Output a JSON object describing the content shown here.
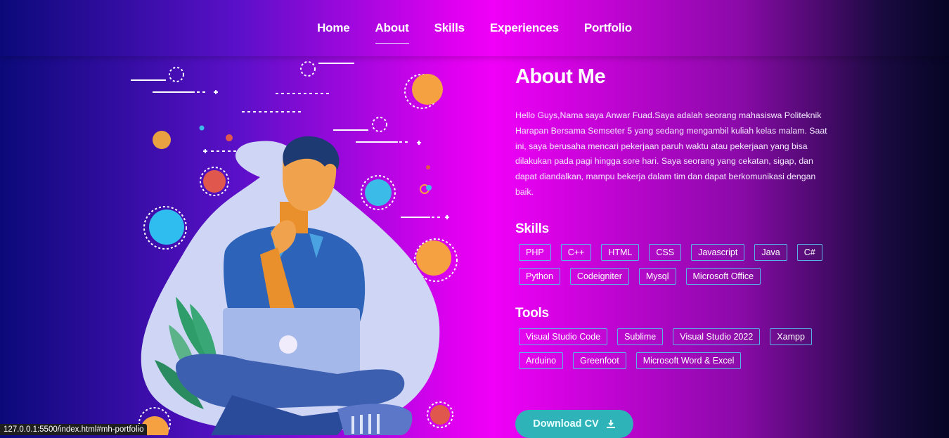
{
  "nav": {
    "items": [
      {
        "label": "Home"
      },
      {
        "label": "About",
        "active": true
      },
      {
        "label": "Skills"
      },
      {
        "label": "Experiences"
      },
      {
        "label": "Portfolio"
      }
    ]
  },
  "about": {
    "title": "About Me",
    "paragraph": "Hello Guys,Nama saya Anwar Fuad.Saya adalah seorang mahasiswa Politeknik Harapan Bersama Semseter 5 yang sedang mengambil kuliah kelas malam. Saat ini, saya berusaha mencari pekerjaan paruh waktu atau pekerjaan yang bisa dilakukan pada pagi hingga sore hari. Saya seorang yang cekatan, sigap, dan dapat diandalkan, mampu bekerja dalam tim dan dapat berkomunikasi dengan baik.",
    "skills_title": "Skills",
    "skills": [
      "PHP",
      "C++",
      "HTML",
      "CSS",
      "Javascript",
      "Java",
      "C#",
      "Python",
      "Codeigniter",
      "Mysql",
      "Microsoft Office"
    ],
    "tools_title": "Tools",
    "tools": [
      "Visual Studio Code",
      "Sublime",
      "Visual Studio 2022",
      "Xampp",
      "Arduino",
      "Greenfoot",
      "Microsoft Word & Excel"
    ],
    "download_label": "Download CV",
    "download_icon": "download-icon"
  },
  "status_bar": {
    "url": "127.0.0.1:5500/index.html#mh-portfolio"
  },
  "colors": {
    "tag_border": "#57b6e8",
    "button": "#2eb3b9",
    "accent_orange": "#f5a142",
    "accent_blue": "#3bbbe8",
    "accent_red": "#e0584d"
  }
}
